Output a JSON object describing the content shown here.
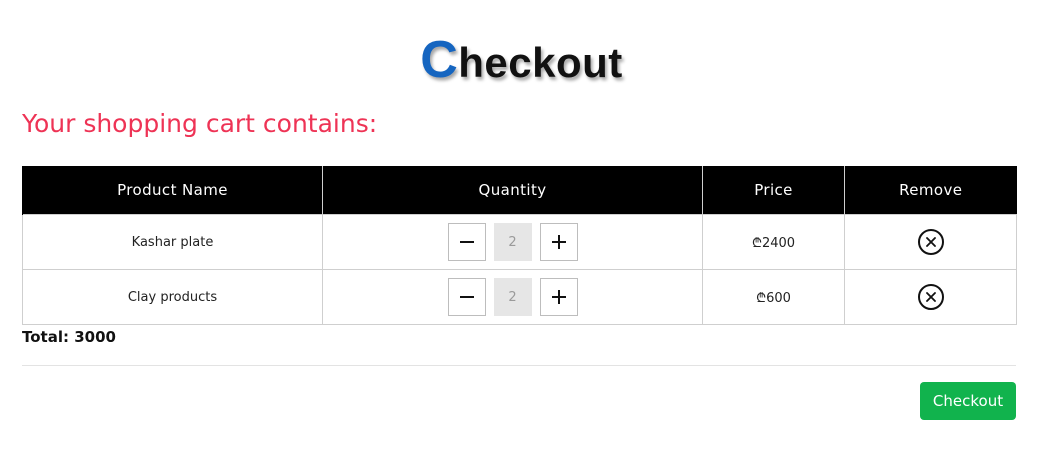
{
  "header": {
    "title_first_letter": "C",
    "title_rest": "heckout"
  },
  "cart": {
    "heading": "Your shopping cart contains:",
    "columns": [
      "Product Name",
      "Quantity",
      "Price",
      "Remove"
    ],
    "rows": [
      {
        "product": "Kashar plate",
        "quantity": "2",
        "price": "₾2400"
      },
      {
        "product": "Clay products",
        "quantity": "2",
        "price": "₾600"
      }
    ],
    "total": "Total: 3000"
  },
  "actions": {
    "checkout_label": "Checkout"
  },
  "colors": {
    "title_accent": "#1565c0",
    "heading": "#ee3355",
    "header_bg": "#000000",
    "checkout_button": "#11b34d"
  },
  "icons": {
    "decrement": "minus-icon",
    "increment": "plus-icon",
    "remove": "remove-circle-x-icon"
  }
}
